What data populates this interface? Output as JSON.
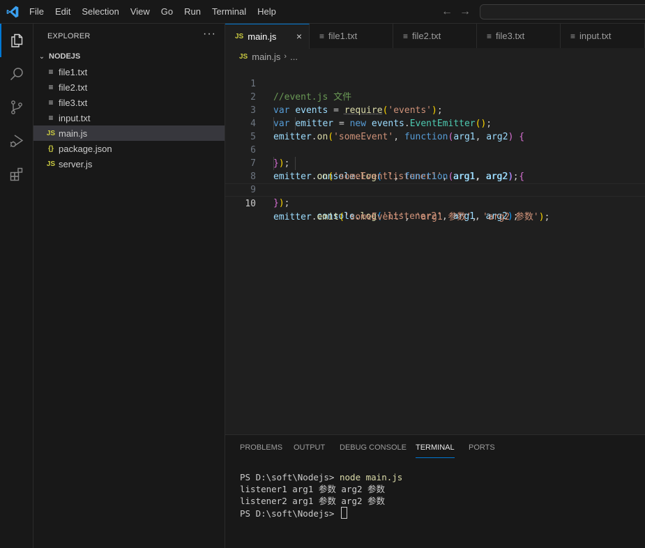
{
  "titlebar": {
    "menu": [
      "File",
      "Edit",
      "Selection",
      "View",
      "Go",
      "Run",
      "Terminal",
      "Help"
    ],
    "back_icon": "←",
    "forward_icon": "→"
  },
  "activity_bar": [
    "explorer-icon",
    "search-icon",
    "source-control-icon",
    "run-debug-icon",
    "extensions-icon"
  ],
  "sidebar": {
    "title": "EXPLORER",
    "more": "···",
    "folder_chevron": "⌄",
    "folder": "NODEJS",
    "files": [
      {
        "icon": "≡",
        "name": "file1.txt",
        "type": "txt"
      },
      {
        "icon": "≡",
        "name": "file2.txt",
        "type": "txt"
      },
      {
        "icon": "≡",
        "name": "file3.txt",
        "type": "txt"
      },
      {
        "icon": "≡",
        "name": "input.txt",
        "type": "txt"
      },
      {
        "icon": "JS",
        "name": "main.js",
        "type": "js"
      },
      {
        "icon": "{}",
        "name": "package.json",
        "type": "json"
      },
      {
        "icon": "JS",
        "name": "server.js",
        "type": "js"
      }
    ]
  },
  "tabs": [
    {
      "icon": "JS",
      "label": "main.js",
      "close": "×"
    },
    {
      "icon": "≡",
      "label": "file1.txt"
    },
    {
      "icon": "≡",
      "label": "file2.txt"
    },
    {
      "icon": "≡",
      "label": "file3.txt"
    },
    {
      "icon": "≡",
      "label": "input.txt"
    }
  ],
  "breadcrumb": {
    "icon": "JS",
    "file": "main.js",
    "sep": "›",
    "rest": "..."
  },
  "editor": {
    "line_numbers": [
      "1",
      "2",
      "3",
      "4",
      "5",
      "6",
      "7",
      "8",
      "9",
      "10"
    ],
    "lines": [
      "//event.js 文件",
      "var events = require('events');",
      "var emitter = new events.EventEmitter();",
      "emitter.on('someEvent', function(arg1, arg2) {",
      "\tconsole.log('listener1', arg1, arg2);",
      "});",
      "emitter.on('someEvent', function(arg1, arg2) {",
      "\tconsole.log('listener2', arg1, arg2);",
      "});",
      "emitter.emit('someEvent', 'arg1 参数', 'arg2 参数');"
    ]
  },
  "panel": {
    "tabs": [
      "PROBLEMS",
      "OUTPUT",
      "DEBUG CONSOLE",
      "TERMINAL",
      "PORTS"
    ],
    "active_tab": "TERMINAL",
    "terminal": {
      "prompt": "PS D:\\soft\\Nodejs> ",
      "command": "node main.js",
      "output": [
        "listener1 arg1 参数 arg2 参数",
        "listener2 arg1 参数 arg2 参数"
      ],
      "prompt2": "PS D:\\soft\\Nodejs> "
    }
  },
  "colors": {
    "accent": "#0078d4",
    "js_icon": "#cbcb41"
  }
}
